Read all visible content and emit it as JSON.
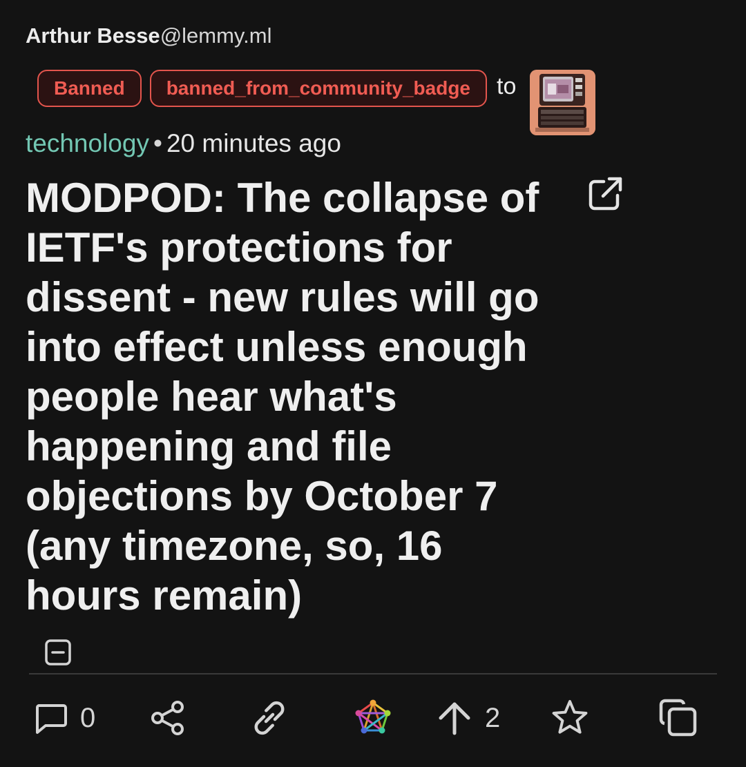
{
  "post": {
    "author_name": "Arthur Besse",
    "author_instance": "@lemmy.ml",
    "badges": [
      "Banned",
      "banned_from_community_badge"
    ],
    "to_label": "to",
    "community": "technology",
    "separator": "•",
    "time_ago": "20 minutes ago",
    "title": "MODPOD: The collapse of IETF's protections for dissent - new rules will go into effect unless enough people hear what's happening and file objections by October 7 (any timezone, so, 16 hours remain)"
  },
  "actions": {
    "comment_count": "0",
    "upvote_count": "2"
  },
  "icons": {
    "external_link": "external-link-icon",
    "collapse": "collapse-icon",
    "comment": "comment-icon",
    "share": "share-icon",
    "link": "link-icon",
    "fediverse": "fediverse-icon",
    "upvote": "upvote-icon",
    "favorite": "star-icon",
    "copy": "copy-icon"
  },
  "colors": {
    "background": "#131313",
    "badge_red": "#e3554d",
    "community_teal": "#73c7b3",
    "text": "#ececec"
  }
}
